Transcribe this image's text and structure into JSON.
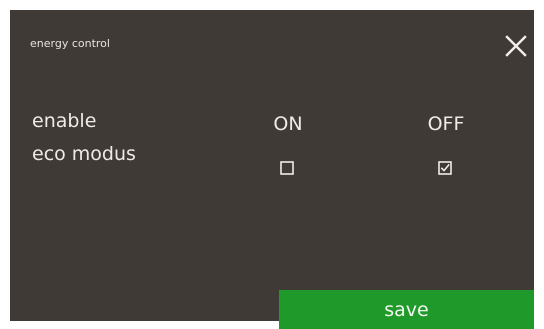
{
  "dialog": {
    "title": "energy control"
  },
  "settings": {
    "label_line1": "enable",
    "label_line2": "eco modus",
    "option_on": "ON",
    "option_off": "OFF",
    "on_checked": false,
    "off_checked": true
  },
  "footer": {
    "save_label": "save"
  },
  "icons": {
    "close": "close-icon",
    "checkbox_empty": "checkbox-empty-icon",
    "checkbox_checked": "checkbox-checked-icon"
  },
  "colors": {
    "panel_background": "#403a36",
    "text": "#eeebe7",
    "save_button": "#1f9a2a"
  }
}
